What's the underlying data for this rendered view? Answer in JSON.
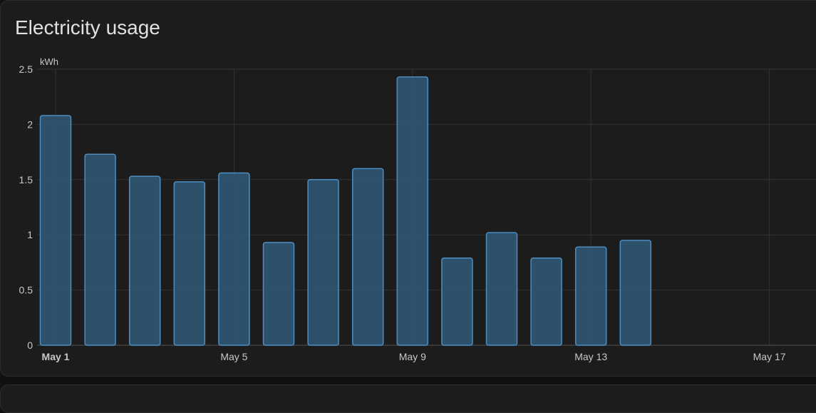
{
  "card": {
    "title": "Electricity usage"
  },
  "colors": {
    "background": "#1c1c1c",
    "bar_fill": "#2f5470",
    "bar_stroke": "#4c8ec4",
    "grid": "#333333",
    "text": "#c8c8c8"
  },
  "chart_data": {
    "type": "bar",
    "unit": "kWh",
    "ylim": [
      0,
      2.5
    ],
    "y_ticks": [
      "0",
      "0.5",
      "1",
      "1.5",
      "2",
      "2.5"
    ],
    "x_ticks": [
      {
        "day": 1,
        "label": "May 1",
        "bold": true
      },
      {
        "day": 5,
        "label": "May 5",
        "bold": false
      },
      {
        "day": 9,
        "label": "May 9",
        "bold": false
      },
      {
        "day": 13,
        "label": "May 13",
        "bold": false
      },
      {
        "day": 17,
        "label": "May 17",
        "bold": false
      }
    ],
    "x_domain": [
      "May 1",
      "May 18"
    ],
    "grid": true,
    "series": [
      {
        "values": [
          {
            "date": "May 1",
            "value": 2.08
          },
          {
            "date": "May 2",
            "value": 1.73
          },
          {
            "date": "May 3",
            "value": 1.53
          },
          {
            "date": "May 4",
            "value": 1.48
          },
          {
            "date": "May 5",
            "value": 1.56
          },
          {
            "date": "May 6",
            "value": 0.93
          },
          {
            "date": "May 7",
            "value": 1.5
          },
          {
            "date": "May 8",
            "value": 1.6
          },
          {
            "date": "May 9",
            "value": 2.43
          },
          {
            "date": "May 10",
            "value": 0.79
          },
          {
            "date": "May 11",
            "value": 1.02
          },
          {
            "date": "May 12",
            "value": 0.79
          },
          {
            "date": "May 13",
            "value": 0.89
          },
          {
            "date": "May 14",
            "value": 0.95
          }
        ]
      }
    ]
  }
}
